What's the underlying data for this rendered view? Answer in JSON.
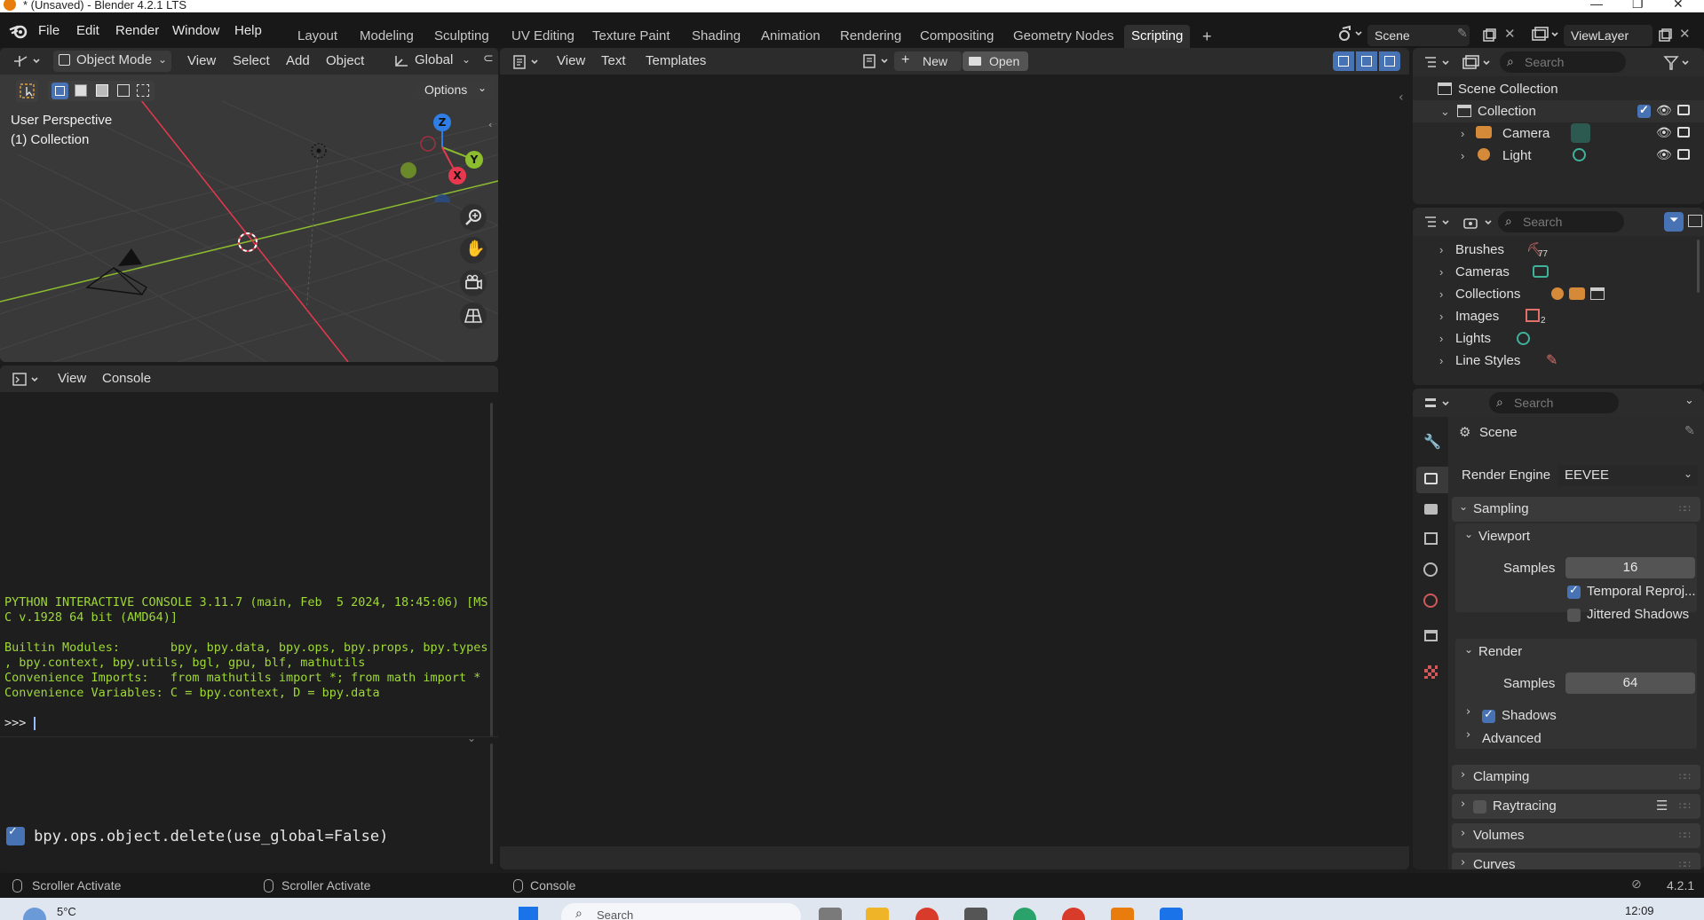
{
  "window": {
    "title": "* (Unsaved) - Blender 4.2.1 LTS",
    "controls": [
      "—",
      "❐",
      "✕"
    ]
  },
  "menubar": {
    "items": [
      "File",
      "Edit",
      "Render",
      "Window",
      "Help"
    ]
  },
  "workspaces": {
    "tabs": [
      "Layout",
      "Modeling",
      "Sculpting",
      "UV Editing",
      "Texture Paint",
      "Shading",
      "Animation",
      "Rendering",
      "Compositing",
      "Geometry Nodes",
      "Scripting"
    ],
    "active": "Scripting",
    "add_label": "+"
  },
  "scene_selector": {
    "value": "Scene"
  },
  "viewlayer_selector": {
    "value": "ViewLayer"
  },
  "viewport": {
    "mode": "Object Mode",
    "menus": [
      "View",
      "Select",
      "Add",
      "Object"
    ],
    "transform_orientation": "Global",
    "options_label": "Options",
    "overlay_title": "User Perspective",
    "overlay_sub": "(1) Collection",
    "gizmo": {
      "z": "Z",
      "y": "Y",
      "x": "X"
    },
    "colors": {
      "x": "#e8384f",
      "y": "#8cbd2f",
      "z": "#2e7ee6",
      "grid": "#454545"
    }
  },
  "console": {
    "menus": [
      "View",
      "Console"
    ],
    "lines": [
      "PYTHON INTERACTIVE CONSOLE 3.11.7 (main, Feb  5 2024, 18:45:06) [MS",
      "C v.1928 64 bit (AMD64)]",
      "",
      "Builtin Modules:       bpy, bpy.data, bpy.ops, bpy.props, bpy.types",
      ", bpy.context, bpy.utils, bgl, gpu, blf, mathutils",
      "Convenience Imports:   from mathutils import *; from math import *",
      "Convenience Variables: C = bpy.context, D = bpy.data"
    ],
    "prompt": ">>> ",
    "info_report": "bpy.ops.object.delete(use_global=False)",
    "text_color": "#9ed936"
  },
  "text_editor": {
    "menus": [
      "View",
      "Text",
      "Templates"
    ],
    "new_label": "New",
    "open_label": "Open"
  },
  "outliner": {
    "search_placeholder": "Search",
    "rows": [
      {
        "label": "Scene Collection"
      },
      {
        "label": "Collection"
      },
      {
        "label": "Camera"
      },
      {
        "label": "Light"
      }
    ]
  },
  "blendfile": {
    "search_placeholder": "Search",
    "rows": [
      {
        "label": "Brushes",
        "count": "77"
      },
      {
        "label": "Cameras",
        "count": ""
      },
      {
        "label": "Collections",
        "count": ""
      },
      {
        "label": "Images",
        "count": "2"
      },
      {
        "label": "Lights",
        "count": ""
      },
      {
        "label": "Line Styles",
        "count": ""
      }
    ]
  },
  "properties": {
    "search_placeholder": "Search",
    "context_title": "Scene",
    "render_engine_label": "Render Engine",
    "render_engine_value": "EEVEE",
    "sampling": "Sampling",
    "viewport_panel": "Viewport",
    "samples_label": "Samples",
    "viewport_samples": "16",
    "temporal_reprojection": "Temporal Reproj...",
    "jittered_shadows": "Jittered Shadows",
    "render_panel": "Render",
    "render_samples": "64",
    "shadows": "Shadows",
    "advanced": "Advanced",
    "clamping": "Clamping",
    "raytracing": "Raytracing",
    "volumes": "Volumes",
    "curves": "Curves"
  },
  "statusbar": {
    "left1": "Scroller Activate",
    "left2": "Scroller Activate",
    "center": "Console",
    "version": "4.2.1"
  },
  "taskbar": {
    "weather": "5°C",
    "search_placeholder": "Search",
    "clock": "12:09"
  }
}
